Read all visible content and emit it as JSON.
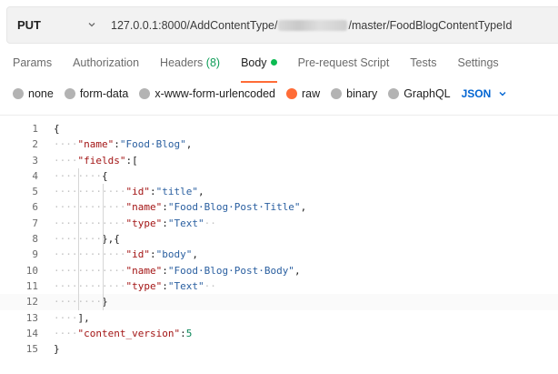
{
  "request": {
    "method": "PUT",
    "url_prefix": "127.0.0.1:8000/AddContentType/",
    "url_suffix": "/master/FoodBlogContentTypeId"
  },
  "tabs": [
    {
      "label": "Params"
    },
    {
      "label": "Authorization"
    },
    {
      "label": "Headers",
      "count": "(8)"
    },
    {
      "label": "Body",
      "active": true
    },
    {
      "label": "Pre-request Script"
    },
    {
      "label": "Tests"
    },
    {
      "label": "Settings"
    }
  ],
  "body_types": [
    {
      "label": "none"
    },
    {
      "label": "form-data"
    },
    {
      "label": "x-www-form-urlencoded"
    },
    {
      "label": "raw",
      "selected": true
    },
    {
      "label": "binary"
    },
    {
      "label": "GraphQL"
    }
  ],
  "format": "JSON",
  "colors": {
    "accent": "#ff6c37",
    "active_dot": "#0cbb52",
    "link": "#0265d2"
  },
  "editor": {
    "line_numbers": [
      "1",
      "2",
      "3",
      "4",
      "5",
      "6",
      "7",
      "8",
      "9",
      "10",
      "11",
      "12",
      "13",
      "14",
      "15"
    ],
    "lines": [
      {
        "dots": "",
        "tokens": [
          {
            "t": "p",
            "v": "{"
          }
        ]
      },
      {
        "dots": "····",
        "tokens": [
          {
            "t": "k",
            "v": "\"name\""
          },
          {
            "t": "p",
            "v": ":"
          },
          {
            "t": "s",
            "v": "\"Food·Blog\""
          },
          {
            "t": "p",
            "v": ","
          }
        ]
      },
      {
        "dots": "····",
        "tokens": [
          {
            "t": "k",
            "v": "\"fields\""
          },
          {
            "t": "p",
            "v": ":["
          }
        ]
      },
      {
        "dots": "········",
        "tokens": [
          {
            "t": "p",
            "v": "{"
          }
        ]
      },
      {
        "dots": "············",
        "tokens": [
          {
            "t": "k",
            "v": "\"id\""
          },
          {
            "t": "p",
            "v": ":"
          },
          {
            "t": "s",
            "v": "\"title\""
          },
          {
            "t": "p",
            "v": ","
          }
        ]
      },
      {
        "dots": "············",
        "tokens": [
          {
            "t": "k",
            "v": "\"name\""
          },
          {
            "t": "p",
            "v": ":"
          },
          {
            "t": "s",
            "v": "\"Food·Blog·Post·Title\""
          },
          {
            "t": "p",
            "v": ","
          }
        ]
      },
      {
        "dots": "············",
        "tokens": [
          {
            "t": "k",
            "v": "\"type\""
          },
          {
            "t": "p",
            "v": ":"
          },
          {
            "t": "s",
            "v": "\"Text\""
          },
          {
            "t": "w",
            "v": "··"
          }
        ]
      },
      {
        "dots": "········",
        "tokens": [
          {
            "t": "p",
            "v": "},{"
          }
        ]
      },
      {
        "dots": "············",
        "tokens": [
          {
            "t": "k",
            "v": "\"id\""
          },
          {
            "t": "p",
            "v": ":"
          },
          {
            "t": "s",
            "v": "\"body\""
          },
          {
            "t": "p",
            "v": ","
          }
        ]
      },
      {
        "dots": "············",
        "tokens": [
          {
            "t": "k",
            "v": "\"name\""
          },
          {
            "t": "p",
            "v": ":"
          },
          {
            "t": "s",
            "v": "\"Food·Blog·Post·Body\""
          },
          {
            "t": "p",
            "v": ","
          }
        ]
      },
      {
        "dots": "············",
        "tokens": [
          {
            "t": "k",
            "v": "\"type\""
          },
          {
            "t": "p",
            "v": ":"
          },
          {
            "t": "s",
            "v": "\"Text\""
          },
          {
            "t": "w",
            "v": "··"
          }
        ]
      },
      {
        "dots": "········",
        "tokens": [
          {
            "t": "p",
            "v": "}"
          }
        ]
      },
      {
        "dots": "····",
        "tokens": [
          {
            "t": "p",
            "v": "],"
          }
        ]
      },
      {
        "dots": "····",
        "tokens": [
          {
            "t": "k",
            "v": "\"content_version\""
          },
          {
            "t": "p",
            "v": ":"
          },
          {
            "t": "n",
            "v": "5"
          }
        ]
      },
      {
        "dots": "",
        "tokens": [
          {
            "t": "p",
            "v": "}"
          }
        ]
      }
    ]
  }
}
